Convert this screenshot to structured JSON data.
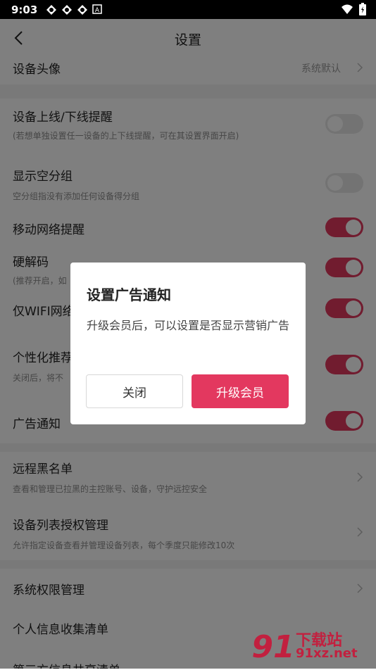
{
  "status_bar": {
    "time": "9:03"
  },
  "nav": {
    "title": "设置"
  },
  "settings": {
    "device_avatar": {
      "label": "设备头像",
      "value": "系统默认"
    },
    "online_notice": {
      "label": "设备上线/下线提醒",
      "desc": "(若想单独设置任一设备的上下线提醒，可在其设置界面开启)",
      "enabled": false
    },
    "show_empty_group": {
      "label": "显示空分组",
      "desc": "空分组指没有添加任何设备得分组",
      "enabled": false
    },
    "mobile_network_notice": {
      "label": "移动网络提醒",
      "enabled": true
    },
    "hardware_decode": {
      "label": "硬解码",
      "desc": "(推荐开启，如",
      "enabled": true
    },
    "wifi_only": {
      "label": "仅WIFI网络",
      "enabled": true
    },
    "personalized": {
      "label": "个性化推荐",
      "desc": "关闭后，将不",
      "enabled": true
    },
    "ad_notice": {
      "label": "广告通知",
      "enabled": true
    },
    "remote_blacklist": {
      "label": "远程黑名单",
      "desc": "查看和管理已拉黑的主控账号、设备，守护远控安全"
    },
    "device_list_auth": {
      "label": "设备列表授权管理",
      "desc": "允许指定设备查看并管理设备列表，每个季度只能修改10次"
    },
    "system_permissions": {
      "label": "系统权限管理"
    },
    "personal_info_list": {
      "label": "个人信息收集清单"
    },
    "third_party_list": {
      "label": "第三方信息共享清单"
    }
  },
  "dialog": {
    "title": "设置广告通知",
    "message": "升级会员后，可以设置是否显示营销广告",
    "close_label": "关闭",
    "upgrade_label": "升级会员"
  },
  "watermark": {
    "text": "下载站",
    "url": "91xz.net"
  },
  "colors": {
    "accent": "#e3385f",
    "toggle_off": "#e6e6e6",
    "background": "#ffffff"
  }
}
